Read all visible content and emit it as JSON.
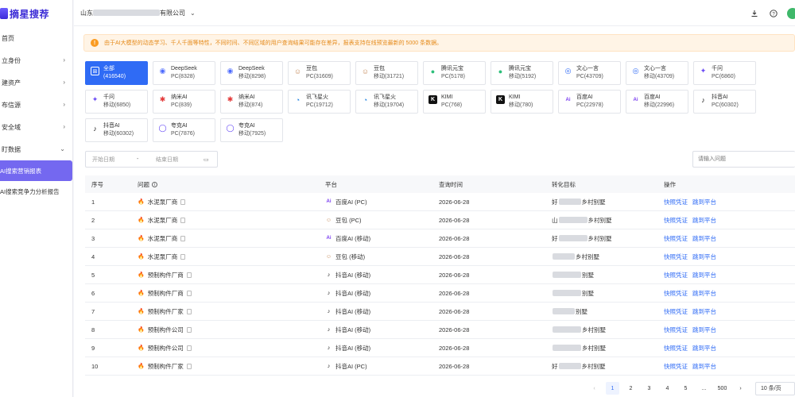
{
  "brand": {
    "name": "摘星搜荐"
  },
  "sidebar": {
    "items": [
      {
        "label": "首页",
        "has_chevron": false
      },
      {
        "label": "立身份",
        "has_chevron": true
      },
      {
        "label": "建资产",
        "has_chevron": true
      },
      {
        "label": "布信源",
        "has_chevron": true
      },
      {
        "label": "安全域",
        "has_chevron": true
      },
      {
        "label": "盯数据",
        "has_chevron": true,
        "expanded": true
      }
    ],
    "sub_items": [
      {
        "label": "AI搜索营销报表",
        "active": true
      },
      {
        "label": "AI搜索竞争力分析报告",
        "active": false
      }
    ]
  },
  "topbar": {
    "company_prefix": "山东",
    "company_suffix": "有限公司"
  },
  "notice": {
    "text": "由于AI大模型的动态学习、千人千面等特性，不同时间、不同区域的用户查询结果可能存在差异，报表支持在线预览最新的 5000 条数据。"
  },
  "platforms": [
    {
      "name": "全部",
      "sub": "(416540)",
      "icon": "grid-icon",
      "color": "#ffffff",
      "active": true
    },
    {
      "name": "DeepSeek",
      "sub": "PC(8328)",
      "icon": "deepseek-icon",
      "color": "#4d6bfe"
    },
    {
      "name": "DeepSeek",
      "sub": "移动(8298)",
      "icon": "deepseek-icon",
      "color": "#4d6bfe"
    },
    {
      "name": "豆包",
      "sub": "PC(31609)",
      "icon": "doubao-icon",
      "color": "#c58a5a"
    },
    {
      "name": "豆包",
      "sub": "移动(31721)",
      "icon": "doubao-icon",
      "color": "#c58a5a"
    },
    {
      "name": "腾讯元宝",
      "sub": "PC(5178)",
      "icon": "yuanbao-icon",
      "color": "#2dbf7a"
    },
    {
      "name": "腾讯元宝",
      "sub": "移动(5192)",
      "icon": "yuanbao-icon",
      "color": "#2dbf7a"
    },
    {
      "name": "文心一言",
      "sub": "PC(43709)",
      "icon": "wenxin-icon",
      "color": "#2f6bf5"
    },
    {
      "name": "文心一言",
      "sub": "移动(43709)",
      "icon": "wenxin-icon",
      "color": "#2f6bf5"
    },
    {
      "name": "千问",
      "sub": "PC(6860)",
      "icon": "qianwen-icon",
      "color": "#6c4cf5"
    },
    {
      "name": "千问",
      "sub": "移动(6850)",
      "icon": "qianwen-icon",
      "color": "#6c4cf5"
    },
    {
      "name": "纳米AI",
      "sub": "PC(839)",
      "icon": "nami-icon",
      "color": "#e33a3a"
    },
    {
      "name": "纳米AI",
      "sub": "移动(874)",
      "icon": "nami-icon",
      "color": "#e33a3a"
    },
    {
      "name": "讯飞星火",
      "sub": "PC(19712)",
      "icon": "xinghuo-icon",
      "color": "#1a7fe0"
    },
    {
      "name": "讯飞星火",
      "sub": "移动(19704)",
      "icon": "xinghuo-icon",
      "color": "#1a7fe0"
    },
    {
      "name": "KIMI",
      "sub": "PC(768)",
      "icon": "kimi-icon",
      "color": "#111111"
    },
    {
      "name": "KIMI",
      "sub": "移动(780)",
      "icon": "kimi-icon",
      "color": "#111111"
    },
    {
      "name": "百度AI",
      "sub": "PC(22978)",
      "icon": "baiduai-icon",
      "color": "#7a3df0"
    },
    {
      "name": "百度AI",
      "sub": "移动(22996)",
      "icon": "baiduai-icon",
      "color": "#7a3df0"
    },
    {
      "name": "抖音AI",
      "sub": "PC(60302)",
      "icon": "douyin-icon",
      "color": "#111111"
    },
    {
      "name": "抖音AI",
      "sub": "移动(60302)",
      "icon": "douyin-icon",
      "color": "#111111"
    },
    {
      "name": "夸克AI",
      "sub": "PC(7876)",
      "icon": "quark-icon",
      "color": "#5b3df5"
    },
    {
      "name": "夸克AI",
      "sub": "移动(7925)",
      "icon": "quark-icon",
      "color": "#5b3df5"
    }
  ],
  "filters": {
    "start_placeholder": "开始日期",
    "separator": "-",
    "end_placeholder": "结束日期",
    "search_placeholder": "请输入问题"
  },
  "table": {
    "headers": [
      "序号",
      "问题",
      "平台",
      "查询时间",
      "转化目标",
      "操作"
    ],
    "action_labels": [
      "快照凭证",
      "跳到平台"
    ],
    "rows": [
      {
        "no": "1",
        "q": "水泥泵厂商",
        "pf": "百度AI (PC)",
        "pf_icon": "baiduai-icon",
        "pf_color": "#7a3df0",
        "time": "2026-06-28",
        "target_pre": "好",
        "target_suf": "乡村别墅"
      },
      {
        "no": "2",
        "q": "水泥泵厂商",
        "pf": "豆包 (PC)",
        "pf_icon": "doubao-icon",
        "pf_color": "#c58a5a",
        "time": "2026-06-28",
        "target_pre": "山",
        "target_suf": "乡村别墅"
      },
      {
        "no": "3",
        "q": "水泥泵厂商",
        "pf": "百度AI (移动)",
        "pf_icon": "baiduai-icon",
        "pf_color": "#7a3df0",
        "time": "2026-06-28",
        "target_pre": "好",
        "target_suf": "乡村别墅"
      },
      {
        "no": "4",
        "q": "水泥泵厂商",
        "pf": "豆包 (移动)",
        "pf_icon": "doubao-icon",
        "pf_color": "#c58a5a",
        "time": "2026-06-28",
        "target_pre": "",
        "target_suf": "乡村别墅"
      },
      {
        "no": "5",
        "q": "预制构件厂商",
        "pf": "抖音AI (移动)",
        "pf_icon": "douyin-icon",
        "pf_color": "#111111",
        "time": "2026-06-28",
        "target_pre": "",
        "target_suf": "别墅"
      },
      {
        "no": "6",
        "q": "预制构件厂商",
        "pf": "抖音AI (移动)",
        "pf_icon": "douyin-icon",
        "pf_color": "#111111",
        "time": "2026-06-28",
        "target_pre": "",
        "target_suf": "别墅"
      },
      {
        "no": "7",
        "q": "预制构件厂家",
        "pf": "抖音AI (移动)",
        "pf_icon": "douyin-icon",
        "pf_color": "#111111",
        "time": "2026-06-28",
        "target_pre": "",
        "target_suf": "别墅"
      },
      {
        "no": "8",
        "q": "预制构件公司",
        "pf": "抖音AI (移动)",
        "pf_icon": "douyin-icon",
        "pf_color": "#111111",
        "time": "2026-06-28",
        "target_pre": "",
        "target_suf": "乡村别墅"
      },
      {
        "no": "9",
        "q": "预制构件公司",
        "pf": "抖音AI (移动)",
        "pf_icon": "douyin-icon",
        "pf_color": "#111111",
        "time": "2026-06-28",
        "target_pre": "",
        "target_suf": "乡村别墅"
      },
      {
        "no": "10",
        "q": "预制构件厂家",
        "pf": "抖音AI (PC)",
        "pf_icon": "douyin-icon",
        "pf_color": "#111111",
        "time": "2026-06-28",
        "target_pre": "好",
        "target_suf": "乡村别墅"
      }
    ]
  },
  "pagination": {
    "prev": "‹",
    "pages": [
      "1",
      "2",
      "3",
      "4",
      "5",
      "...",
      "500"
    ],
    "current": "1",
    "next": "›",
    "page_size": "10 条/页"
  },
  "colors": {
    "accent": "#2f6bf5",
    "sidebar_active": "#7468f0",
    "notice_text": "#e58a1a"
  }
}
